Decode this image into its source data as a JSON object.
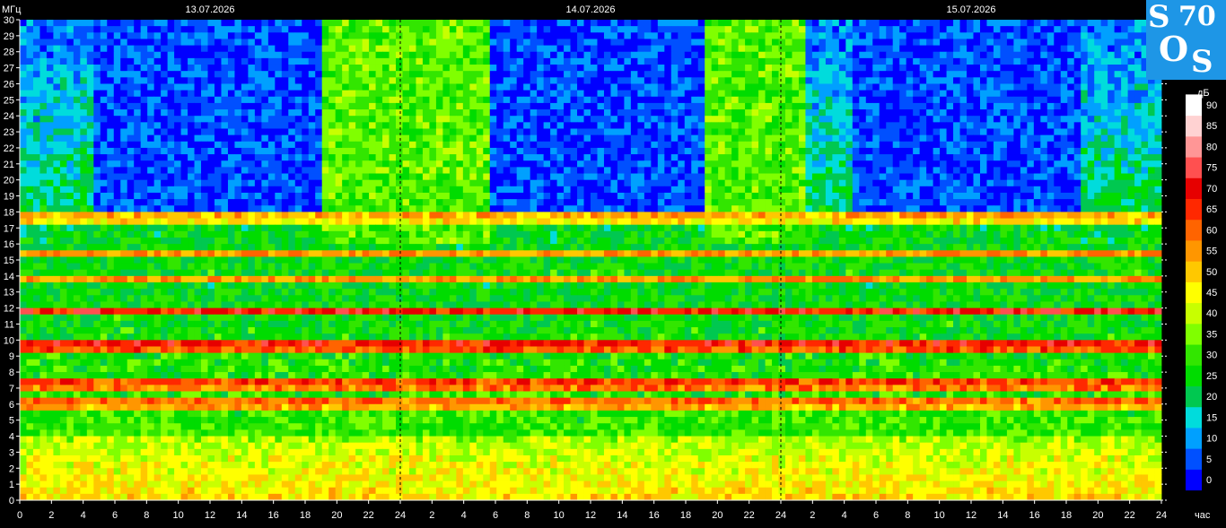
{
  "chart_data": {
    "type": "heatmap",
    "y_unit_label": "МГц",
    "x_unit_label": "час",
    "colorbar_unit_label": "дБ",
    "date_labels": [
      "13.07.2026",
      "14.07.2026",
      "15.07.2026"
    ],
    "y_range": [
      0,
      30
    ],
    "y_ticks": [
      0,
      1,
      2,
      3,
      4,
      5,
      6,
      7,
      8,
      9,
      10,
      11,
      12,
      13,
      14,
      15,
      16,
      17,
      18,
      19,
      20,
      21,
      22,
      23,
      24,
      25,
      26,
      27,
      28,
      29,
      30
    ],
    "x_tick_labels": [
      "0",
      "2",
      "4",
      "6",
      "8",
      "10",
      "12",
      "14",
      "16",
      "18",
      "20",
      "22",
      "24",
      "2",
      "4",
      "6",
      "8",
      "10",
      "12",
      "14",
      "16",
      "18",
      "20",
      "22",
      "24",
      "2",
      "4",
      "6",
      "8",
      "10",
      "12",
      "14",
      "16",
      "18",
      "20",
      "22",
      "24"
    ],
    "x_range_hours": [
      0,
      72
    ],
    "colorbar": {
      "ticks": [
        0,
        5,
        10,
        15,
        20,
        25,
        30,
        35,
        40,
        45,
        50,
        55,
        60,
        65,
        70,
        75,
        80,
        85,
        90
      ],
      "colors": [
        "#0000ff",
        "#0050ff",
        "#00a0ff",
        "#00dcdc",
        "#00c850",
        "#00dc00",
        "#32e600",
        "#80ff00",
        "#c8ff00",
        "#ffff00",
        "#ffc800",
        "#ff9600",
        "#ff6400",
        "#ff2800",
        "#e60000",
        "#ff5050",
        "#ff9696",
        "#ffd2d2",
        "#ffffff"
      ]
    },
    "bands_mhz": [
      {
        "freq": 9.7,
        "level_db": 70
      },
      {
        "freq": 11.8,
        "level_db": 68
      },
      {
        "freq": 7.3,
        "level_db": 66
      },
      {
        "freq": 6.1,
        "level_db": 62
      },
      {
        "freq": 13.8,
        "level_db": 55
      },
      {
        "freq": 15.4,
        "level_db": 55
      },
      {
        "freq": 17.7,
        "level_db": 55
      }
    ],
    "day_columns_hours": [
      [
        19,
        29.5
      ],
      [
        43,
        49.5
      ]
    ],
    "grid": false,
    "legend": "right"
  },
  "logo": {
    "chars": [
      "S",
      "70",
      "O",
      "S"
    ]
  }
}
